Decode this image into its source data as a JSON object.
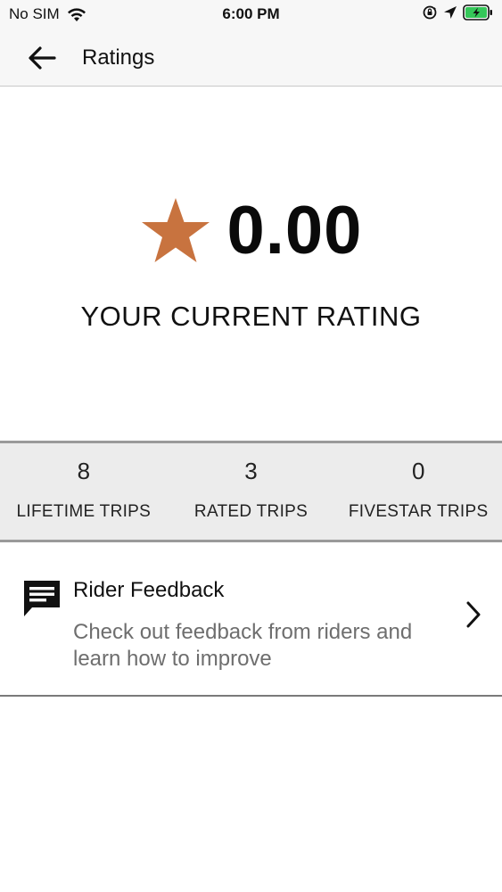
{
  "status_bar": {
    "carrier": "No SIM",
    "time": "6:00 PM",
    "icons": [
      "wifi-icon",
      "orientation-lock-icon",
      "location-arrow-icon",
      "battery-charging-icon"
    ],
    "battery_color": "#35c759"
  },
  "header": {
    "back_icon": "arrow-left-icon",
    "title": "Ratings"
  },
  "rating": {
    "value": "0.00",
    "caption": "YOUR CURRENT RATING",
    "star_icon": "star-icon",
    "star_color": "#c8733f"
  },
  "stats": [
    {
      "value": "8",
      "label": "LIFETIME TRIPS"
    },
    {
      "value": "3",
      "label": "RATED TRIPS"
    },
    {
      "value": "0",
      "label": "FIVESTAR TRIPS"
    }
  ],
  "feedback": {
    "icon": "message-icon",
    "title": "Rider Feedback",
    "description": "Check out feedback from riders and learn how to improve",
    "chevron_icon": "chevron-right-icon"
  }
}
